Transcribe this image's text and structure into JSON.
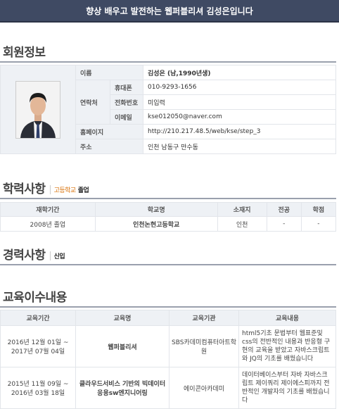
{
  "banner": "향상 배우고 발전하는 웹퍼블리셔 김성은입니다",
  "member": {
    "title": "회원정보",
    "name_label": "이름",
    "name_value": "김성은 (남,1990년생)",
    "contact_label": "연락처",
    "mobile_label": "휴대폰",
    "mobile_value": "010-9293-1656",
    "phone_label": "전화번호",
    "phone_value": "미입력",
    "email_label": "이메일",
    "email_value": "kse012050@naver.com",
    "homepage_label": "홈페이지",
    "homepage_value": "http://210.217.48.5/web/kse/step_3",
    "address_label": "주소",
    "address_value": "인천 남동구 만수동"
  },
  "education": {
    "title": "학력사항",
    "sub_highlight": "고등학교",
    "sub_status": "졸업",
    "headers": [
      "재학기간",
      "학교명",
      "소재지",
      "전공",
      "학점"
    ],
    "rows": [
      [
        "2008년 졸업",
        "인천논현고등학교",
        "인천",
        "-",
        "-"
      ]
    ]
  },
  "career": {
    "title": "경력사항",
    "sub_status": "신입"
  },
  "training": {
    "title": "교육이수내용",
    "headers": [
      "교육기간",
      "교육명",
      "교육기관",
      "교육내용"
    ],
    "rows": [
      {
        "period_start": "2016년 12월 01일 ~",
        "period_end": "2017년 07월 04일",
        "name": "웹퍼블리셔",
        "institution": "SBS카데미컴퓨터아트학원",
        "content": "html5기초 문법부터 웹표준및 css의 전반적인 내용과 반응형 구현의 교육을 받았고 자바스크립트와 JQ의 기초를 배웠습니다"
      },
      {
        "period_start": "2015년 11월 09일 ~",
        "period_end": "2016년 03월 18일",
        "name": "클라우드서비스 기반의 빅데이터 응용sw엔지니어링",
        "institution": "에이콘아카데미",
        "content": "데이터베이스부터 자바 자바스크립트 제이쿼리 제이에스피까지 전반적인 개발자의 기초를 배웠습니다"
      }
    ]
  }
}
